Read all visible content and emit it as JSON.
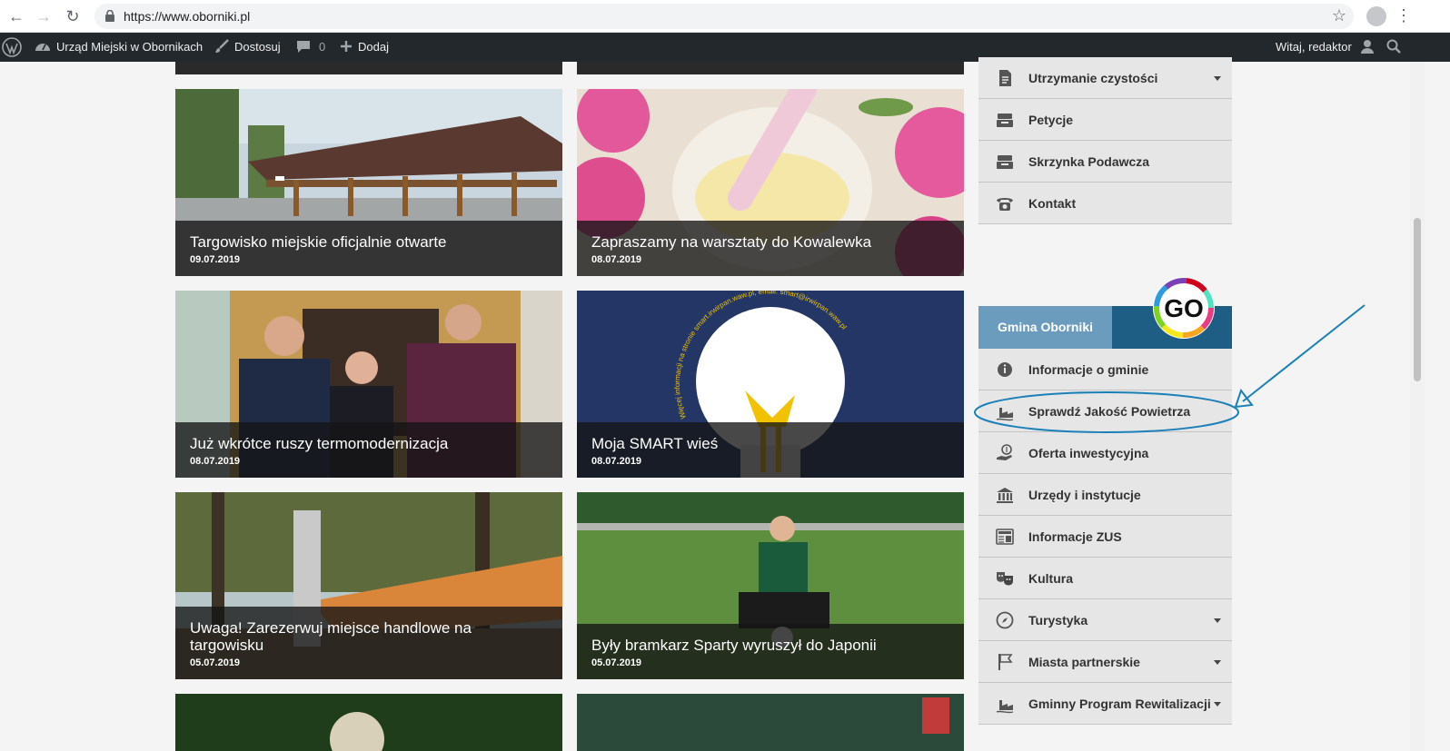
{
  "browser": {
    "url": "https://www.oborniki.pl",
    "back_glyph": "←",
    "forward_glyph": "→",
    "reload_glyph": "↻",
    "star_glyph": "☆",
    "menu_glyph": "⋮"
  },
  "adminbar": {
    "site_name": "Urząd Miejski w Obornikach",
    "customize": "Dostosuj",
    "comments_count": "0",
    "new": "Dodaj",
    "greeting": "Witaj, redaktor"
  },
  "posts": [
    {
      "title": "Targowisko miejskie oficjalnie otwarte",
      "date": "09.07.2019"
    },
    {
      "title": "Zapraszamy na warsztaty do Kowalewka",
      "date": "08.07.2019"
    },
    {
      "title": "Już wkrótce ruszy termomodernizacja",
      "date": "08.07.2019"
    },
    {
      "title": "Moja SMART wieś",
      "date": "08.07.2019"
    },
    {
      "title": "Uwaga! Zarezerwuj miejsce handlowe na targowisku",
      "date": "05.07.2019"
    },
    {
      "title": "Były bramkarz Sparty wyruszył do Japonii",
      "date": "05.07.2019"
    }
  ],
  "smart_arc_text": "Więcej informacji na stronie smart.irwirpan.waw.pl, email: smart@irwirpan.waw.pl",
  "sidebar_top": [
    {
      "label": "Utrzymanie czystości",
      "icon": "document-icon",
      "dropdown": true
    },
    {
      "label": "Petycje",
      "icon": "inbox-icon",
      "dropdown": false
    },
    {
      "label": "Skrzynka Podawcza",
      "icon": "inbox-icon",
      "dropdown": false
    },
    {
      "label": "Kontakt",
      "icon": "phone-icon",
      "dropdown": false
    }
  ],
  "gmina": {
    "tab_label": "Gmina Oborniki",
    "badge": "GO"
  },
  "sidebar_gmina": [
    {
      "label": "Informacje o gminie",
      "icon": "info-icon",
      "dropdown": false
    },
    {
      "label": "Sprawdź Jakość Powietrza",
      "icon": "factory-icon",
      "dropdown": false
    },
    {
      "label": "Oferta inwestycyjna",
      "icon": "money-hand-icon",
      "dropdown": false
    },
    {
      "label": "Urzędy i instytucje",
      "icon": "bank-icon",
      "dropdown": false
    },
    {
      "label": "Informacje ZUS",
      "icon": "news-icon",
      "dropdown": false
    },
    {
      "label": "Kultura",
      "icon": "theater-masks-icon",
      "dropdown": false
    },
    {
      "label": "Turystyka",
      "icon": "compass-icon",
      "dropdown": true
    },
    {
      "label": "Miasta partnerskie",
      "icon": "flag-icon",
      "dropdown": true
    },
    {
      "label": "Gminny Program Rewitalizacji",
      "icon": "factory-icon",
      "dropdown": true
    }
  ],
  "colors": {
    "adminbar": "#23282d",
    "sidebar_item": "#e6e6e6",
    "gmina_header": "#1e5e85",
    "gmina_tab": "#6b9bbd",
    "annotation": "#1b80b8"
  }
}
